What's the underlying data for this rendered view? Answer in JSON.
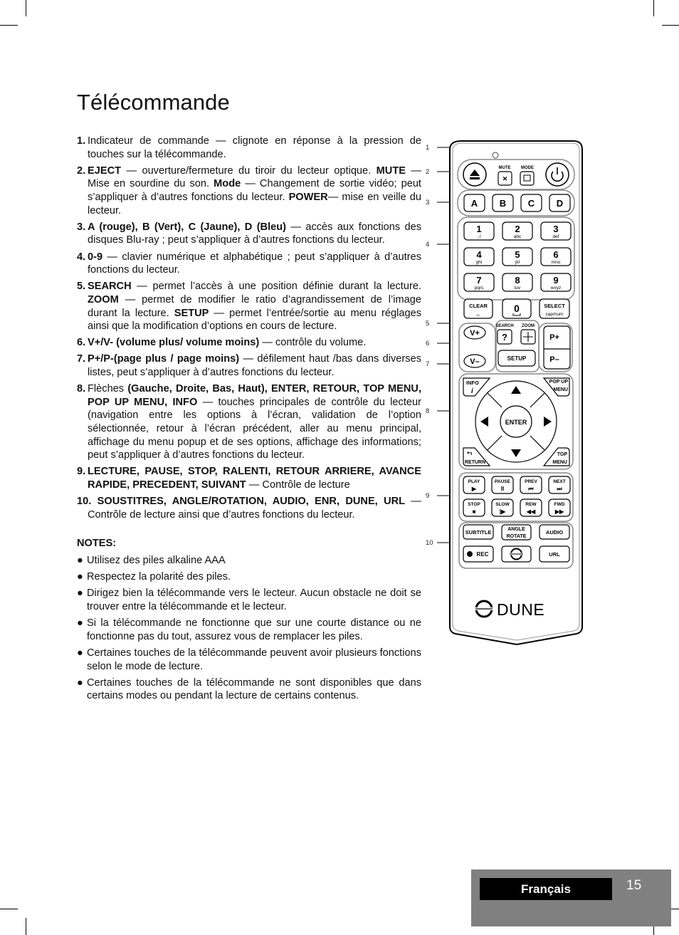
{
  "page": {
    "title": "Télécommande",
    "language_tab": "Français",
    "page_number": "15"
  },
  "items": [
    {
      "num": "1.",
      "parts": [
        {
          "t": "Indicateur de commande — clignote en réponse à la pression de touches sur la télécommande.",
          "b": false
        }
      ]
    },
    {
      "num": "2.",
      "parts": [
        {
          "t": "EJECT",
          "b": true
        },
        {
          "t": " — ouverture/fermeture du tiroir du lecteur optique. ",
          "b": false
        },
        {
          "t": "MUTE",
          "b": true
        },
        {
          "t": " — Mise en sourdine du son. ",
          "b": false
        },
        {
          "t": "Mode",
          "b": true
        },
        {
          "t": " — Changement de sortie vidéo; peut s’appliquer à d’autres fonctions du lecteur. ",
          "b": false
        },
        {
          "t": "POWER",
          "b": true
        },
        {
          "t": "— mise en veille du lecteur.",
          "b": false
        }
      ]
    },
    {
      "num": "3.",
      "parts": [
        {
          "t": "A (rouge), B (Vert), C (Jaune), D (Bleu)",
          "b": true
        },
        {
          "t": " — accès aux fonctions des disques Blu-ray ; peut s’appliquer à d’autres fonctions du lecteur.",
          "b": false
        }
      ]
    },
    {
      "num": "4.",
      "parts": [
        {
          "t": "0-9",
          "b": true
        },
        {
          "t": " — clavier numérique et alphabétique ; peut s’appliquer à d’autres fonctions du lecteur.",
          "b": false
        }
      ]
    },
    {
      "num": "5.",
      "parts": [
        {
          "t": "SEARCH",
          "b": true
        },
        {
          "t": " — permet l’accès à une position définie durant la lecture. ",
          "b": false
        },
        {
          "t": "ZOOM",
          "b": true
        },
        {
          "t": " — permet de modifier le ratio d’agrandissement de l’image durant la lecture. ",
          "b": false
        },
        {
          "t": "SETUP",
          "b": true
        },
        {
          "t": " — permet l’entrée/sortie au menu réglages ainsi que la modification d’options en cours de lecture.",
          "b": false
        }
      ]
    },
    {
      "num": "6.",
      "parts": [
        {
          "t": "V+/V- (volume plus/ volume moins)",
          "b": true
        },
        {
          "t": " — contrôle du volume.",
          "b": false
        }
      ]
    },
    {
      "num": "7.",
      "parts": [
        {
          "t": "P+/P-(page plus / page moins)",
          "b": true
        },
        {
          "t": " — défilement haut /bas dans diverses listes, peut s’appliquer à d’autres fonctions du lecteur.",
          "b": false
        }
      ]
    },
    {
      "num": "8.",
      "parts": [
        {
          "t": "Flèches ",
          "b": false
        },
        {
          "t": "(Gauche, Droite, Bas, Haut), ENTER, RETOUR, TOP MENU, POP UP MENU, INFO",
          "b": true
        },
        {
          "t": " — touches principales de contrôle du lecteur (navigation entre les options à l’écran, validation de l’option sélectionnée, retour à l’écran précédent, aller au menu principal, affichage du menu popup et de ses options, affichage des informations; peut s’appliquer à d’autres fonctions du lecteur.",
          "b": false
        }
      ]
    },
    {
      "num": "9.",
      "parts": [
        {
          "t": "LECTURE, PAUSE, STOP, RALENTI, RETOUR ARRIERE, AVANCE RAPIDE, PRECEDENT, SUIVANT",
          "b": true
        },
        {
          "t": " — Contrôle de lecture",
          "b": false
        }
      ]
    },
    {
      "num": "10.",
      "parts": [
        {
          "t": " SOUSTITRES, ANGLE/ROTATION, AUDIO, ENR, DUNE, URL",
          "b": true
        },
        {
          "t": " — Contrôle de lecture ainsi que d’autres fonctions du lecteur.",
          "b": false
        }
      ]
    }
  ],
  "notes": {
    "heading": "NOTES:",
    "bullet": "●",
    "items": [
      "Utilisez des piles alkaline AAA",
      "Respectez la polarité des piles.",
      "Dirigez bien la télécommande vers le lecteur. Aucun obstacle ne doit se trouver entre la télécommande et le lecteur.",
      "Si la télécommande ne fonctionne que sur une courte distance ou ne fonctionne pas du tout, assurez vous de remplacer les piles.",
      " Certaines touches de la télécommande peuvent avoir plusieurs fonctions selon le mode de lecture.",
      "Certaines touches de la télécommande ne sont disponibles que dans certains modes ou pendant la lecture de certains contenus."
    ]
  },
  "callouts": [
    "1",
    "2",
    "3",
    "4",
    "5",
    "6",
    "7",
    "8",
    "9",
    "10"
  ],
  "remote": {
    "mute": "MUTE",
    "mode": "MODE",
    "color_keys": [
      "A",
      "B",
      "C",
      "D"
    ],
    "digits": [
      {
        "d": "1",
        "s": ".:/"
      },
      {
        "d": "2",
        "s": "abc"
      },
      {
        "d": "3",
        "s": "def"
      },
      {
        "d": "4",
        "s": "ghi"
      },
      {
        "d": "5",
        "s": "jkl"
      },
      {
        "d": "6",
        "s": "mno"
      },
      {
        "d": "7",
        "s": "pqrs"
      },
      {
        "d": "8",
        "s": "tuv"
      },
      {
        "d": "9",
        "s": "wxyz"
      }
    ],
    "clear": "CLEAR",
    "zero": "0",
    "select": "SELECT",
    "select_sub": "cap/num",
    "search": "SEARCH",
    "zoom": "ZOOM",
    "search_glyph": "?",
    "setup": "SETUP",
    "vol_up": "V+",
    "vol_down": "V–",
    "page_up": "P+",
    "page_down": "P–",
    "info": "INFO",
    "info_glyph": "i",
    "popup1": "POP UP",
    "popup2": "MENU",
    "enter": "ENTER",
    "return": "RETURN",
    "top1": "TOP",
    "top2": "MENU",
    "transport": [
      {
        "label": "PLAY",
        "glyph": "▶"
      },
      {
        "label": "PAUSE",
        "glyph": "II"
      },
      {
        "label": "PREV",
        "glyph": "⏮"
      },
      {
        "label": "NEXT",
        "glyph": "⏭"
      },
      {
        "label": "STOP",
        "glyph": "■"
      },
      {
        "label": "SLOW",
        "glyph": "|▶"
      },
      {
        "label": "REW",
        "glyph": "◀◀"
      },
      {
        "label": "FWD",
        "glyph": "▶▶"
      }
    ],
    "subtitle": "SUBTITLE",
    "angle1": "ANGLE",
    "angle2": "ROTATE",
    "audio": "AUDIO",
    "rec": "REC",
    "url": "URL",
    "brand": "DUNE"
  }
}
